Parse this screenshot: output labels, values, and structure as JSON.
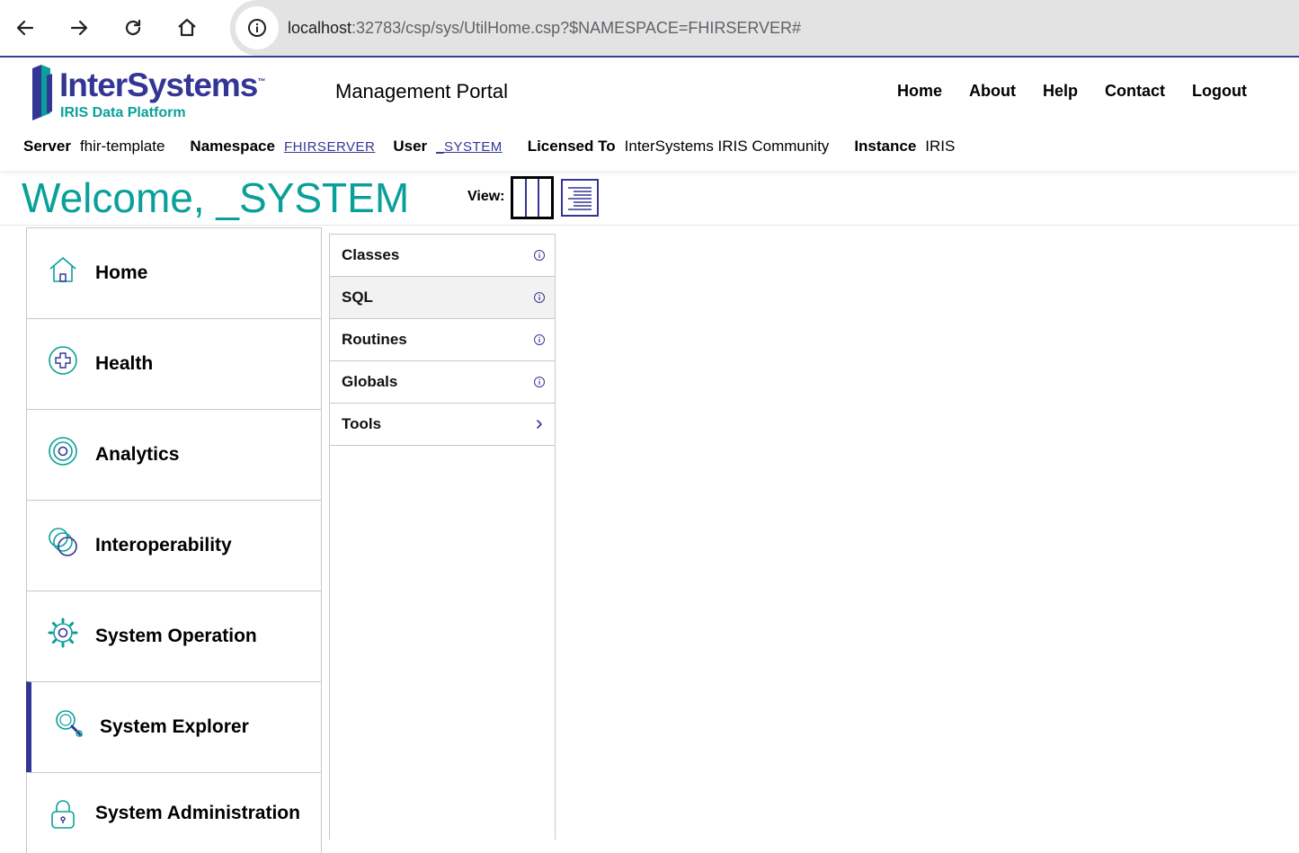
{
  "browser": {
    "url_host": "localhost",
    "url_rest": ":32783/csp/sys/UtilHome.csp?$NAMESPACE=FHIRSERVER#"
  },
  "header": {
    "logo_name": "InterSystems",
    "logo_tm": "™",
    "logo_sub": "IRIS Data Platform",
    "portal_title": "Management Portal",
    "links": [
      "Home",
      "About",
      "Help",
      "Contact",
      "Logout"
    ]
  },
  "info": {
    "server_label": "Server",
    "server_value": "fhir-template",
    "namespace_label": "Namespace",
    "namespace_value": "FHIRSERVER",
    "user_label": "User",
    "user_value": "_SYSTEM",
    "licensed_label": "Licensed To",
    "licensed_value": "InterSystems IRIS Community",
    "instance_label": "Instance",
    "instance_value": "IRIS"
  },
  "welcome": "Welcome, _SYSTEM",
  "view_label": "View:",
  "menu": [
    {
      "label": "Home",
      "icon": "house-icon"
    },
    {
      "label": "Health",
      "icon": "health-plus-icon"
    },
    {
      "label": "Analytics",
      "icon": "target-icon"
    },
    {
      "label": "Interoperability",
      "icon": "interlinked-circles-icon"
    },
    {
      "label": "System Operation",
      "icon": "gear-icon"
    },
    {
      "label": "System Explorer",
      "icon": "magnifier-icon",
      "active": true
    },
    {
      "label": "System Administration",
      "icon": "lock-icon"
    }
  ],
  "submenu": [
    {
      "label": "Classes",
      "icon": "info-icon"
    },
    {
      "label": "SQL",
      "icon": "info-icon"
    },
    {
      "label": "Routines",
      "icon": "info-icon"
    },
    {
      "label": "Globals",
      "icon": "info-icon"
    },
    {
      "label": "Tools",
      "icon": "chevron-right-icon"
    }
  ],
  "colors": {
    "teal": "#0aa09a",
    "navy": "#333695",
    "border": "#c8c8c8"
  }
}
